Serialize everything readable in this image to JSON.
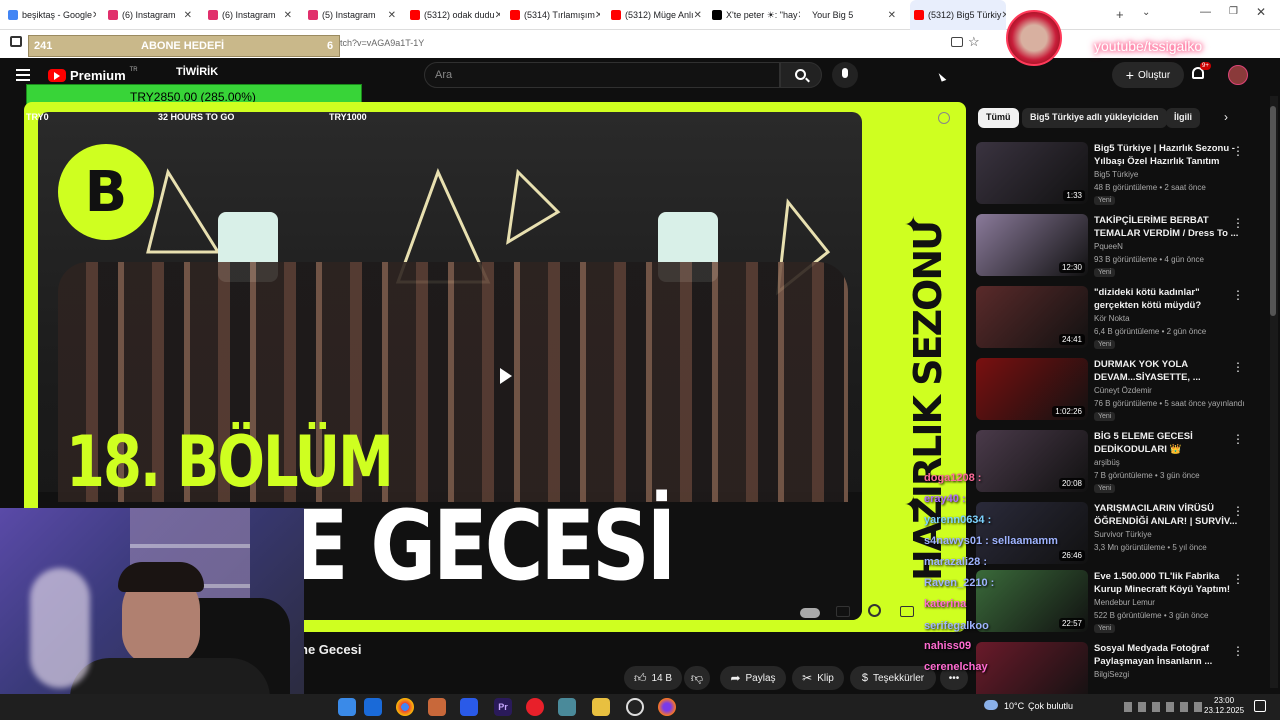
{
  "browser": {
    "tabs": [
      {
        "label": "beşiktaş - Google",
        "color": "#4285f4"
      },
      {
        "label": "(6) Instagram",
        "color": "#e1306c"
      },
      {
        "label": "(6) Instagram",
        "color": "#e1306c"
      },
      {
        "label": "(5) Instagram",
        "color": "#e1306c"
      },
      {
        "label": "(5312) odak dudu",
        "color": "#ff0000"
      },
      {
        "label": "(5314) Tırlamışım",
        "color": "#ff0000"
      },
      {
        "label": "(5312) Müge Anlı",
        "color": "#ff0000"
      },
      {
        "label": "X'te peter ☀: \"hay",
        "color": "#000000"
      },
      {
        "label": "Your Big 5",
        "color": "#ffffff"
      },
      {
        "label": "(5312) Big5 Türkiy",
        "color": "#ff0000"
      }
    ],
    "url_fragment": "tch?v=vAGA9a1T-1Y"
  },
  "overlay": {
    "subscriber_goal_left": "241",
    "subscriber_goal_label": "ABONE HEDEFİ",
    "subscriber_goal_right": "6",
    "brand": "TİWİRİK",
    "donation_total": "TRY2850.00 (285.00%)",
    "goal_start": "TRY0",
    "goal_time": "32 HOURS TO GO",
    "goal_end": "TRY1000",
    "streamer_handle": "youtube/tssigalko"
  },
  "youtube": {
    "logo_label": "Premium",
    "logo_region": "TR",
    "search_placeholder": "Ara",
    "create_label": "Oluştur",
    "notif_count": "9+",
    "chips": [
      "Tümü",
      "Big5 Türkiye adlı yükleyiciden",
      "İlgili"
    ],
    "video_title_tail": "ne Gecesi",
    "like_count": "14 B",
    "share_label": "Paylaş",
    "clip_label": "Klip",
    "thanks_label": "Teşekkürler",
    "more_label": "•••"
  },
  "thumbnail_text": {
    "episode": "18. BÖLÜM",
    "subtitle": "ELEME GECESİ",
    "side": "HAZIRLIK SEZONU"
  },
  "sidebar": [
    {
      "title": "Big5 Türkiye | Hazırlık Sezonu - Yılbaşı Özel Hazırlık Tanıtım",
      "channel": "Big5 Türkiye",
      "meta": "48 B görüntüleme • 2 saat önce",
      "duration": "1:33",
      "badge": "Yeni",
      "thumb": "#3a3340"
    },
    {
      "title": "TAKİPÇİLERİME BERBAT TEMALAR VERDİM / Dress To ...",
      "channel": "PqueeN",
      "meta": "93 B görüntüleme • 4 gün önce",
      "duration": "12:30",
      "badge": "Yeni",
      "thumb": "#8a7a9a"
    },
    {
      "title": "\"dizideki kötü kadınlar\" gerçekten kötü müydü?",
      "channel": "Kör Nokta",
      "meta": "6,4 B görüntüleme • 2 gün önce",
      "duration": "24:41",
      "badge": "Yeni",
      "thumb": "#5a2a2a"
    },
    {
      "title": "DURMAK YOK YOLA DEVAM...SİYASETTE, ...",
      "channel": "Cüneyt Özdemir",
      "meta": "76 B görüntüleme • 5 saat önce yayınlandı",
      "duration": "1:02:26",
      "badge": "Yeni",
      "thumb": "#7a1010"
    },
    {
      "title": "BİG 5 ELEME GECESİ DEDİKODULARI 👑",
      "channel": "arşibüş",
      "meta": "7 B görüntüleme • 3 gün önce",
      "duration": "20:08",
      "badge": "Yeni",
      "thumb": "#4a3a4a"
    },
    {
      "title": "YARIŞMACILARIN VİRÜSÜ ÖĞRENDİĞİ ANLAR! | SURVİV...",
      "channel": "Survivor Türkiye",
      "meta": "3,3 Mn görüntüleme • 5 yıl önce",
      "duration": "26:46",
      "badge": "",
      "thumb": "#2a2a3a"
    },
    {
      "title": "Eve 1.500.000 TL'lik Fabrika Kurup Minecraft Köyü Yaptım!",
      "channel": "Mendebur Lemur",
      "meta": "522 B görüntüleme • 3 gün önce",
      "duration": "22:57",
      "badge": "Yeni",
      "thumb": "#3a6a3a"
    },
    {
      "title": "Sosyal Medyada Fotoğraf Paylaşmayan İnsanların ...",
      "channel": "BilgiSezgi",
      "meta": "",
      "duration": "",
      "badge": "",
      "thumb": "#6a1a2a"
    }
  ],
  "chat": [
    {
      "name": "doga1208 :",
      "color": "#ff6b9a"
    },
    {
      "name": "eray40 :",
      "color": "#b06bff"
    },
    {
      "name": "yarenn0634 :",
      "color": "#7dd3ff"
    },
    {
      "name": "s4nawys01 : sellaamamm",
      "color": "#9fb4ff"
    },
    {
      "name": "marazali28 :",
      "color": "#9fb4ff"
    },
    {
      "name": "Raven_2210 :",
      "color": "#9fb4ff"
    },
    {
      "name": "katerina",
      "color": "#ff6bd1"
    },
    {
      "name": "serifegalkoo",
      "color": "#9fb4ff"
    },
    {
      "name": "nahiss09",
      "color": "#ff6bd1"
    },
    {
      "name": "cerenelchay",
      "color": "#ff6bd1"
    }
  ],
  "taskbar": {
    "weather_temp": "10°C",
    "weather_desc": "Çok bulutlu",
    "time": "23:00",
    "date": "23.12.2025"
  }
}
